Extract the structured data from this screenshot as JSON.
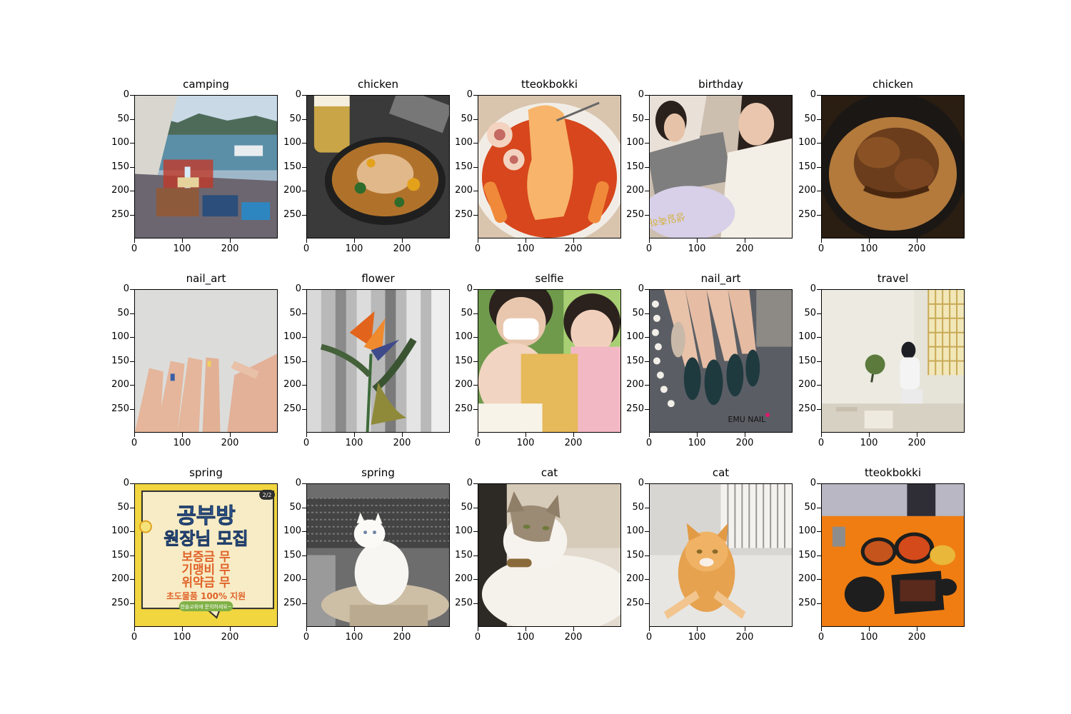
{
  "figure": {
    "panels": [
      {
        "title": "camping",
        "scene": "camping"
      },
      {
        "title": "chicken",
        "scene": "chicken-pan"
      },
      {
        "title": "tteokbokki",
        "scene": "tteokbokki-cheese"
      },
      {
        "title": "birthday",
        "scene": "birthday"
      },
      {
        "title": "chicken",
        "scene": "chicken-roast"
      },
      {
        "title": "nail_art",
        "scene": "nails-plain"
      },
      {
        "title": "flower",
        "scene": "flower"
      },
      {
        "title": "selfie",
        "scene": "selfie"
      },
      {
        "title": "nail_art",
        "scene": "nails-dark"
      },
      {
        "title": "travel",
        "scene": "travel"
      },
      {
        "title": "spring",
        "scene": "poster"
      },
      {
        "title": "spring",
        "scene": "cat-white"
      },
      {
        "title": "cat",
        "scene": "cat-tabby"
      },
      {
        "title": "cat",
        "scene": "cat-orange"
      },
      {
        "title": "tteokbokki",
        "scene": "tteokbokki-table"
      }
    ],
    "y_ticks": [
      "0",
      "50",
      "100",
      "150",
      "200",
      "250"
    ],
    "x_ticks": [
      "0",
      "100",
      "200"
    ],
    "poster_text": {
      "line1": "공부방",
      "line2": "원장님 모집",
      "line3": "보증금 무",
      "line4": "기맹비 무",
      "line5": "위약금 무",
      "line6": "초도물품 100% 지원",
      "footer": "한솔교육에 문의하세요~",
      "badge": "2/2"
    },
    "nail_watermark": "EMU NAIL",
    "birthday_pillow_text": "생일축하",
    "colors": {
      "axis": "#000000",
      "poster_yellow": "#f2d640",
      "poster_blue": "#3f7fd0",
      "poster_orange": "#e0632a",
      "table_orange": "#f07d12"
    }
  }
}
